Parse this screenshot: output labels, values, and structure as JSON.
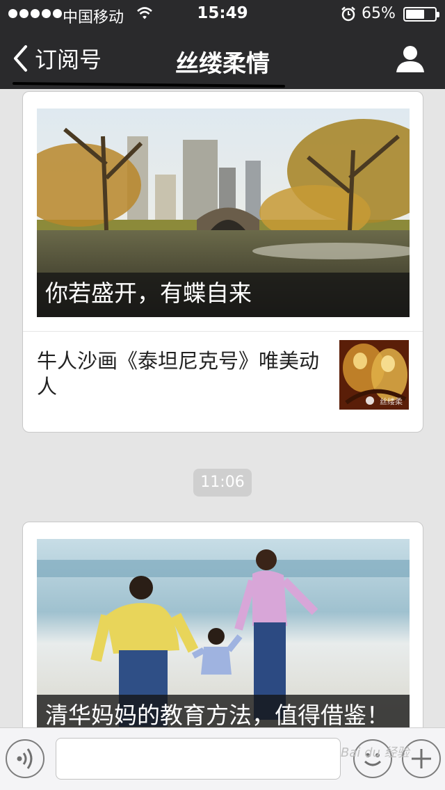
{
  "status_bar": {
    "carrier": "中国移动",
    "time": "15:49",
    "battery_percent": "65%",
    "battery_level": 0.65
  },
  "nav": {
    "back_label": "订阅号",
    "title": "丝缕柔情"
  },
  "messages": [
    {
      "cover_caption": "你若盛开，有蝶自来",
      "sub_title": "牛人沙画《泰坦尼克号》唯美动人",
      "thumb_watermark": "丝缕柔"
    },
    {
      "cover_caption": "清华妈妈的教育方法，值得借鉴！"
    }
  ],
  "time_divider": "11:06",
  "watermark": "Bai du 经验",
  "colors": {
    "bar_bg": "#2a2a2c",
    "chat_bg": "#e5e5e5",
    "caption_bg": "#141414"
  }
}
